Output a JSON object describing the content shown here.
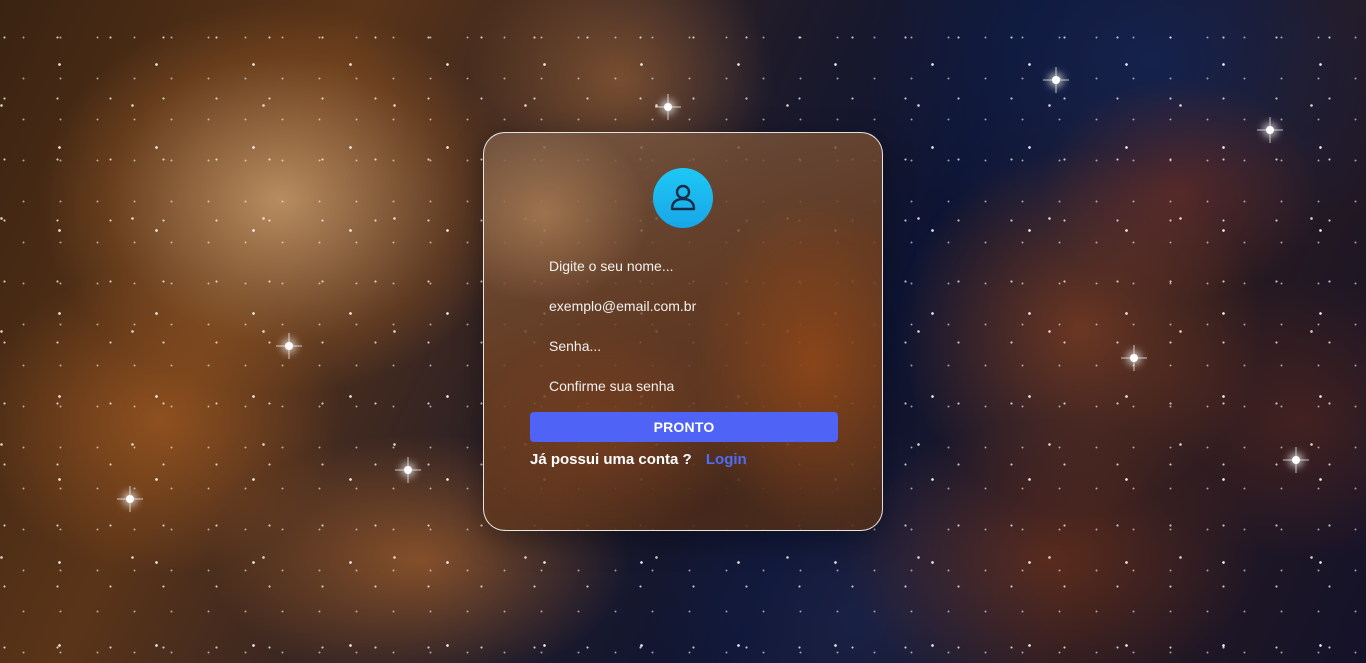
{
  "background": {
    "description_icon": "nebula-starfield-background"
  },
  "register": {
    "avatar_icon": "user-icon",
    "name_placeholder": "Digite o seu nome...",
    "email_placeholder": "exemplo@email.com.br",
    "password_placeholder": "Senha...",
    "confirm_placeholder": "Confirme sua senha",
    "submit_label": "PRONTO",
    "have_account_text": "Já possui uma conta ?",
    "login_link": "Login"
  },
  "colors": {
    "accent": "#5063f7",
    "link": "#4f6cf5",
    "avatar_gradient_top": "#1ec8f5",
    "avatar_gradient_bottom": "#18a6e8"
  }
}
